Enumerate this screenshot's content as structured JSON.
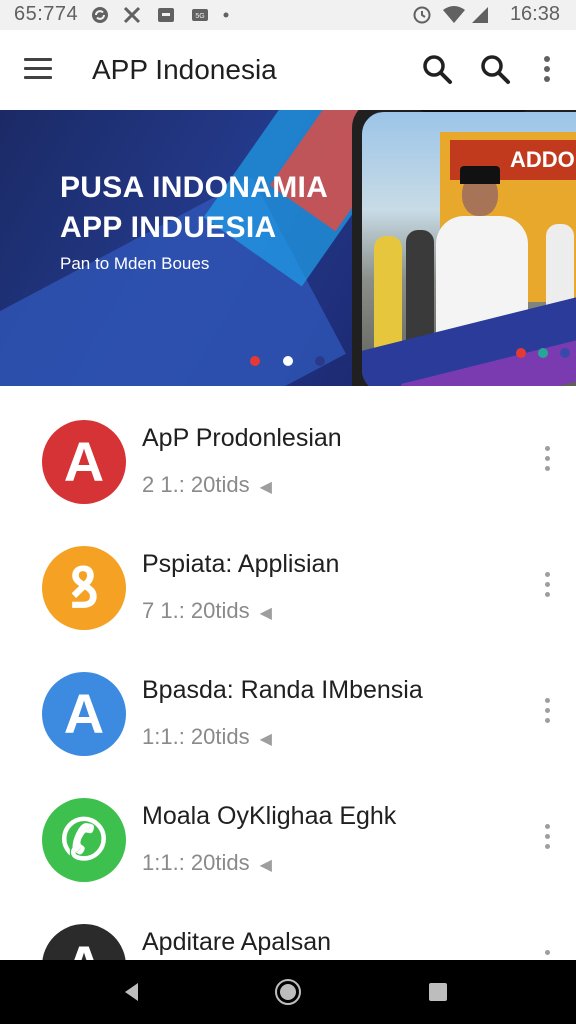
{
  "status_bar": {
    "time": "65:774",
    "clock": "16:38",
    "icons": [
      "sync-icon",
      "no-signal-icon",
      "notification-icon",
      "cast-icon",
      "dot-icon",
      "alarm-icon",
      "wifi-icon",
      "signal-icon"
    ]
  },
  "app_bar": {
    "title": "APP Indonesia",
    "menu_icon": "hamburger-menu-icon",
    "actions": [
      "search-icon",
      "search-icon",
      "more-vert-icon"
    ]
  },
  "banner": {
    "headline_line1": "PUSA INDONAMIA",
    "headline_line2": "APP INDUESIA",
    "subtitle": "Pan to Mden Boues",
    "phone_sign": "ADDO",
    "left_dots": {
      "count": 3,
      "active_index": 1
    },
    "right_dots": [
      "#e53935",
      "#26a69a",
      "#3949ab"
    ]
  },
  "apps": [
    {
      "title": "ApP Prodonlesian",
      "meta": "2 1.: 20tids",
      "icon": "letter-a-icon",
      "icon_glyph": "A",
      "color": "#d63336"
    },
    {
      "title": "Pspiata: Applisian",
      "meta": "7 1.: 20tids",
      "icon": "ribbon-icon",
      "icon_glyph": "ꝸ",
      "color": "#f5a123"
    },
    {
      "title": "Bpasda: Randa IMbensia",
      "meta": "1:1.: 20tids",
      "icon": "letter-a-icon",
      "icon_glyph": "A",
      "color": "#3c8be0"
    },
    {
      "title": "Moala OyKlighaa Eghk",
      "meta": "1:1.: 20tids",
      "icon": "phone-icon",
      "icon_glyph": "✆",
      "color": "#3ec04e"
    },
    {
      "title": "Apditare Apalsan",
      "meta": "",
      "icon": "letter-a-icon",
      "icon_glyph": "A",
      "color": "#2b2b2b"
    }
  ],
  "nav_bar": [
    "back-icon",
    "home-icon",
    "recents-icon"
  ]
}
